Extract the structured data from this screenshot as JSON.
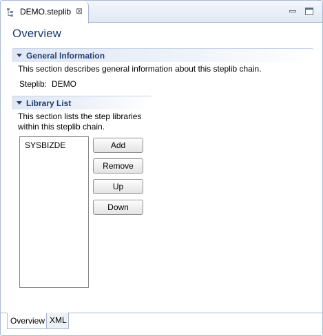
{
  "editor_tab": {
    "title": "DEMO.steplib",
    "close_glyph": "⊠",
    "icon": "tree-file-icon"
  },
  "window_controls": {
    "minimize_icon": "minimize-icon",
    "maximize_icon": "maximize-icon"
  },
  "form": {
    "title": "Overview"
  },
  "general_information": {
    "title": "General Information",
    "description": "This section describes general information about this steplib chain.",
    "steplib_label": "Steplib:",
    "steplib_value": "DEMO"
  },
  "library_list": {
    "title": "Library List",
    "description_line1": "This section lists the step libraries",
    "description_line2": "within this steplib chain.",
    "items": [
      "SYSBIZDE"
    ],
    "buttons": {
      "add": "Add",
      "remove": "Remove",
      "up": "Up",
      "down": "Down"
    }
  },
  "page_tabs": [
    {
      "label": "Overview",
      "selected": true
    },
    {
      "label": "XML",
      "selected": false
    }
  ],
  "colors": {
    "accent": "#1f3f73",
    "border": "#a9b8d0"
  }
}
